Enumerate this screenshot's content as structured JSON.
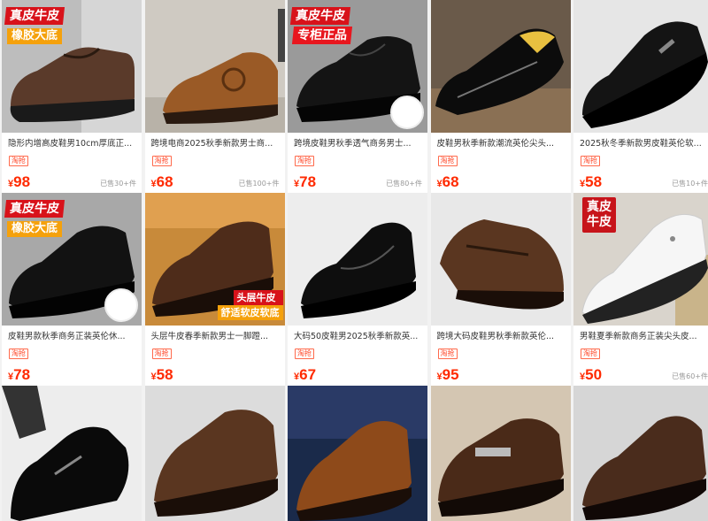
{
  "products": [
    {
      "title": "隐形内增高皮鞋男10cm厚底正...",
      "tag": "淘抢",
      "price_symbol": "¥",
      "price": "98",
      "sold": "已售30+件",
      "badges": [
        "真皮牛皮",
        "橡胶大底"
      ],
      "shoe_color": "#5a3a2a",
      "bg": "#bdbdbd"
    },
    {
      "title": "跨境电商2025秋季新款男士商...",
      "tag": "淘抢",
      "price_symbol": "¥",
      "price": "68",
      "sold": "已售100+件",
      "badges": [],
      "shoe_color": "#9a5a26",
      "bg": "#cfcac2"
    },
    {
      "title": "跨境皮鞋男秋季透气商务男士...",
      "tag": "淘抢",
      "price_symbol": "¥",
      "price": "78",
      "sold": "已售80+件",
      "badges": [
        "真皮牛皮",
        "专柜正品"
      ],
      "shoe_color": "#141414",
      "bg": "#9a9a9a"
    },
    {
      "title": "皮鞋男秋季新款潮流英伦尖头...",
      "tag": "淘抢",
      "price_symbol": "¥",
      "price": "68",
      "sold": "",
      "badges": [],
      "shoe_color": "#0c0c0c",
      "bg": "#6a5a4a"
    },
    {
      "title": "2025秋冬季新款男皮鞋英伦软...",
      "tag": "淘抢",
      "price_symbol": "¥",
      "price": "58",
      "sold": "已售10+件",
      "badges": [],
      "shoe_color": "#141414",
      "bg": "#e6e6e6"
    },
    {
      "title": "皮鞋男款秋季商务正装英伦休...",
      "tag": "淘抢",
      "price_symbol": "¥",
      "price": "78",
      "sold": "",
      "badges": [
        "真皮牛皮",
        "橡胶大底"
      ],
      "shoe_color": "#121212",
      "bg": "#a8a8a8"
    },
    {
      "title": "头层牛皮春季新款男士一脚蹬...",
      "tag": "淘抢",
      "price_symbol": "¥",
      "price": "58",
      "sold": "",
      "badges": [
        "头层牛皮",
        "舒适软皮软底"
      ],
      "shoe_color": "#4e2c1a",
      "bg": "#c88a3a"
    },
    {
      "title": "大码50皮鞋男2025秋季新款英...",
      "tag": "淘抢",
      "price_symbol": "¥",
      "price": "67",
      "sold": "",
      "badges": [],
      "shoe_color": "#0e0e0e",
      "bg": "#ededed"
    },
    {
      "title": "跨境大码皮鞋男秋季新款英伦...",
      "tag": "淘抢",
      "price_symbol": "¥",
      "price": "95",
      "sold": "",
      "badges": [],
      "shoe_color": "#5a3620",
      "bg": "#e8e8e8"
    },
    {
      "title": "男鞋夏季新款商务正装尖头皮...",
      "tag": "淘抢",
      "price_symbol": "¥",
      "price": "50",
      "sold": "已售60+件",
      "badges": [
        "真皮",
        "牛皮"
      ],
      "shoe_color": "#f6f6f6",
      "bg": "#d9d4cc"
    },
    {
      "shoe_color": "#0a0a0a",
      "bg": "#ededed"
    },
    {
      "shoe_color": "#5a3620",
      "bg": "#dcdcdc"
    },
    {
      "shoe_color": "#8e4a1a",
      "bg": "#1a2a4a"
    },
    {
      "shoe_color": "#4a2a18",
      "bg": "#d4c6b2"
    },
    {
      "shoe_color": "#4a2c1c",
      "bg": "#d6d6d6"
    }
  ],
  "icons": {
    "inset": "shoe-thumbnail-icon"
  }
}
